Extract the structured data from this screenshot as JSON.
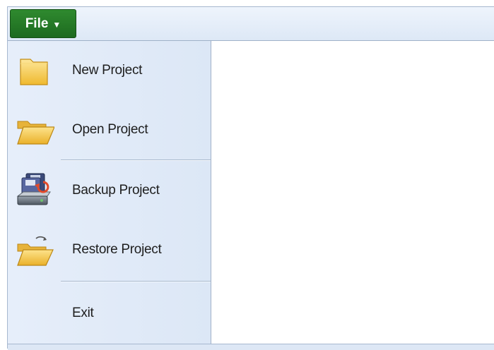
{
  "ribbon": {
    "file_tab": {
      "label": "File",
      "caret": "▼"
    }
  },
  "menu": {
    "items": [
      {
        "label": "New Project",
        "icon": "folder-closed-icon"
      },
      {
        "label": "Open Project",
        "icon": "folder-open-icon"
      },
      {
        "label": "Backup Project",
        "icon": "backup-drive-icon"
      },
      {
        "label": "Restore Project",
        "icon": "restore-folder-icon"
      },
      {
        "label": "Exit",
        "icon": ""
      }
    ]
  },
  "colors": {
    "file_tab": "#237a25",
    "menu_background": "#e1eaf7",
    "folder": "#f3c54a"
  }
}
